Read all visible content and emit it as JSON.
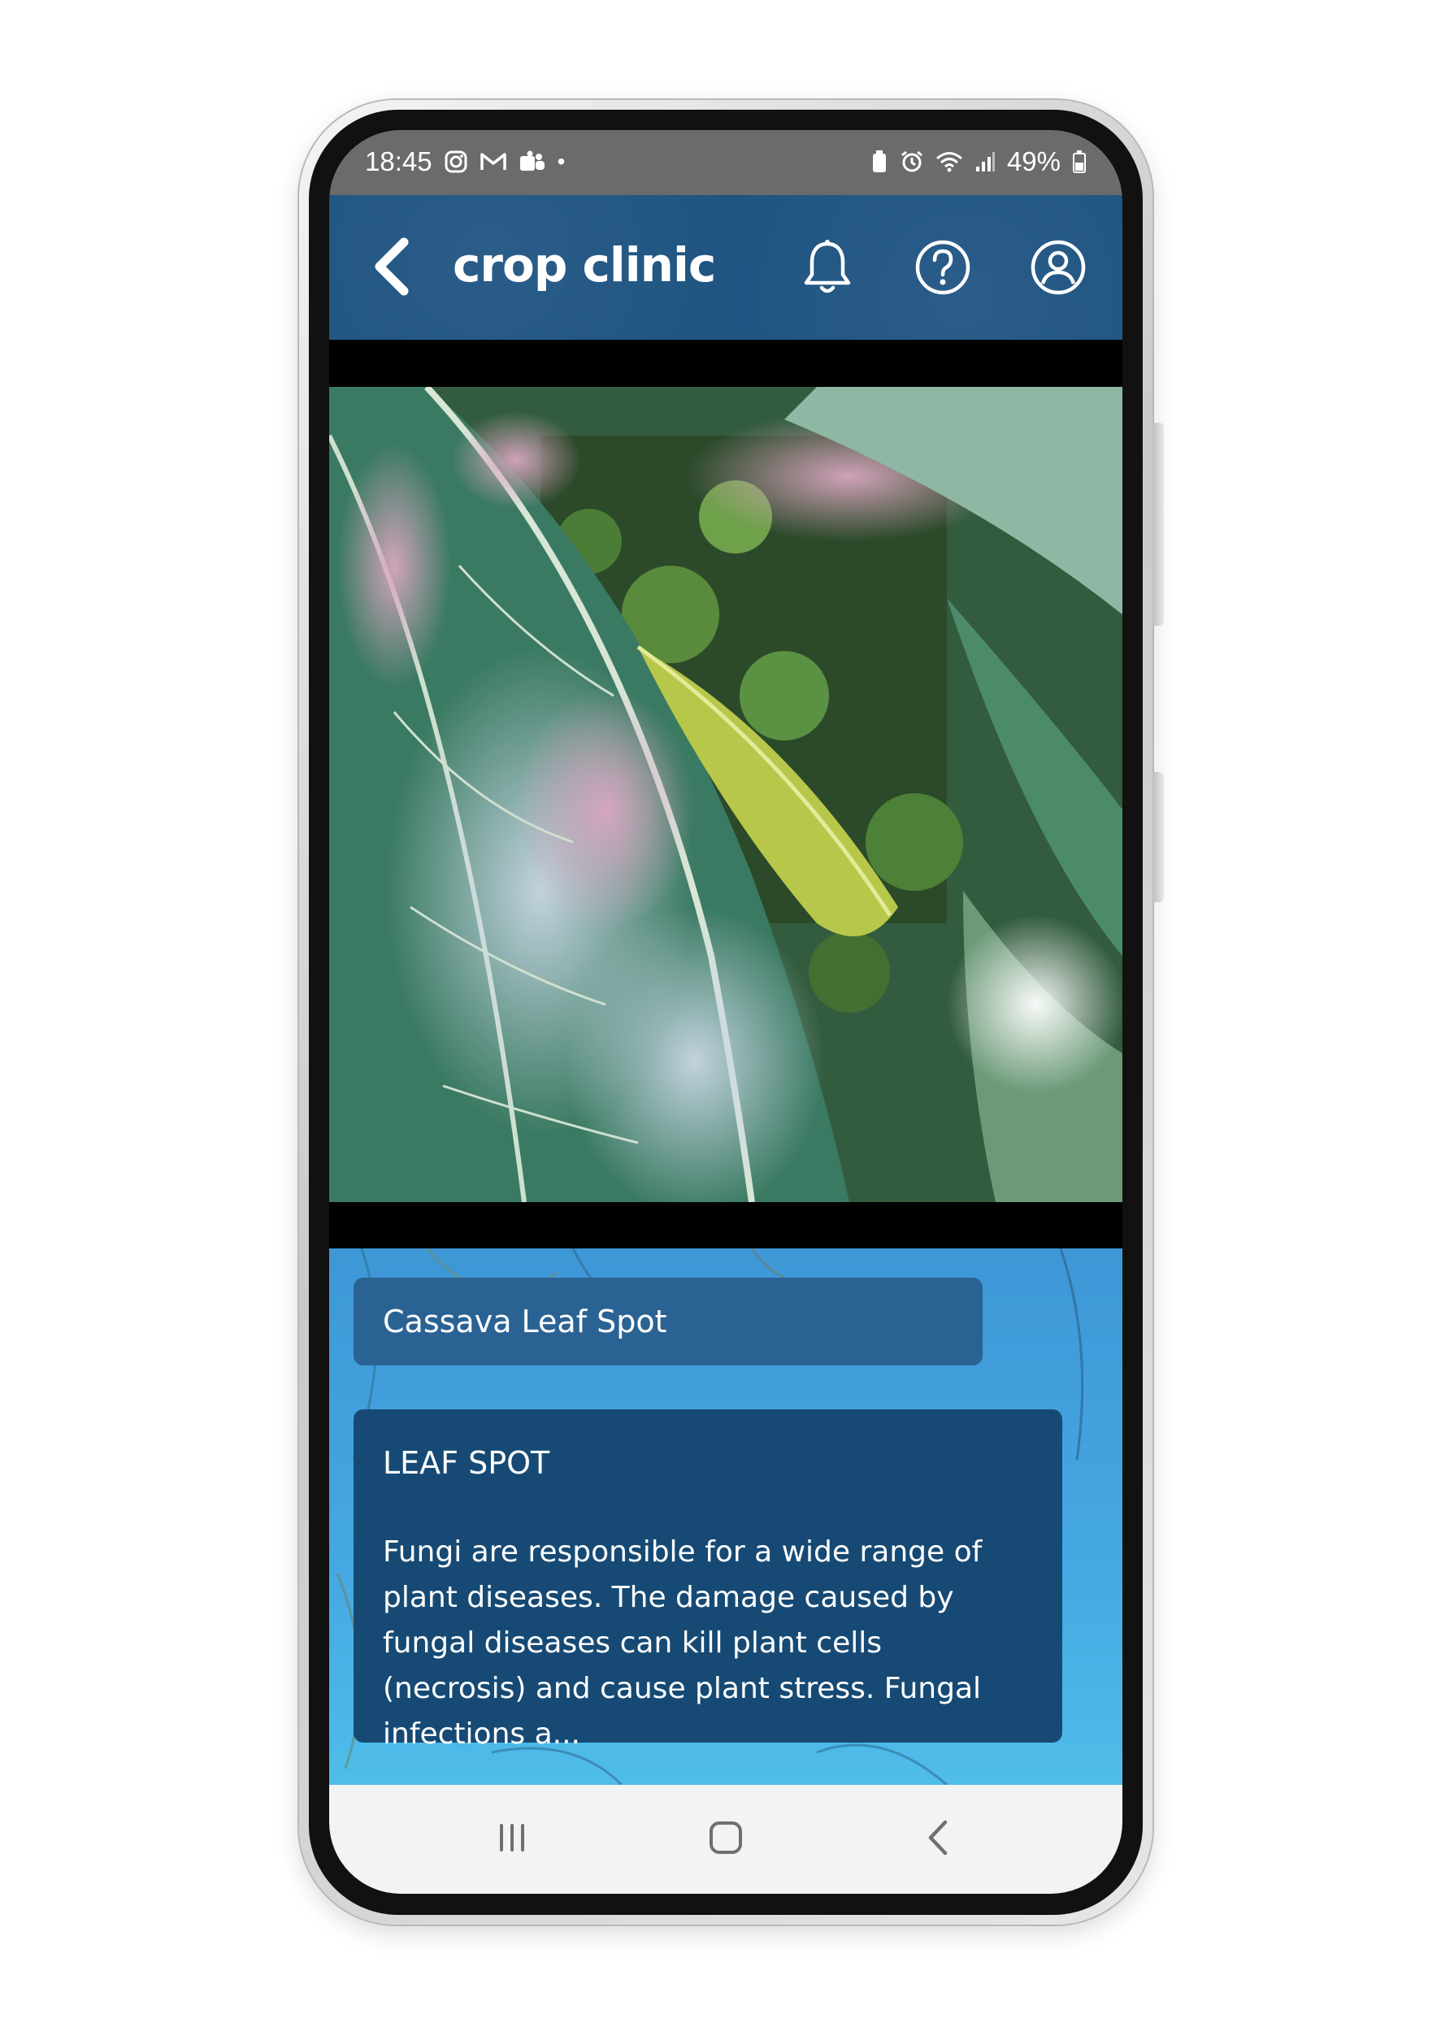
{
  "status_bar": {
    "time": "18:45",
    "battery": "49%",
    "left_icons": [
      "instagram-icon",
      "gmail-icon",
      "teams-icon",
      "dot-icon"
    ],
    "right_icons": [
      "battery-saver-icon",
      "alarm-icon",
      "wifi-icon",
      "signal-icon",
      "battery-icon"
    ]
  },
  "header": {
    "title": "crop clinic",
    "icons": [
      "back-arrow-icon",
      "bell-icon",
      "help-icon",
      "profile-icon"
    ]
  },
  "diagnosis": {
    "disease_name": "Cassava Leaf Spot",
    "info_title": "LEAF SPOT",
    "info_body": "Fungi are responsible for a wide range of plant diseases. The damage caused by fungal diseases can kill plant cells (necrosis) and cause plant stress. Fungal infections a..."
  },
  "nav_bar": {
    "icons": [
      "recent-apps-icon",
      "home-icon",
      "back-icon"
    ]
  },
  "colors": {
    "header": "#1f5482",
    "content_top": "#3e97d6",
    "content_bottom": "#4fbde9",
    "disease_name_bg": "#2a6393",
    "info_card_bg": "#164a74",
    "status_bar": "#6b6b6b"
  }
}
